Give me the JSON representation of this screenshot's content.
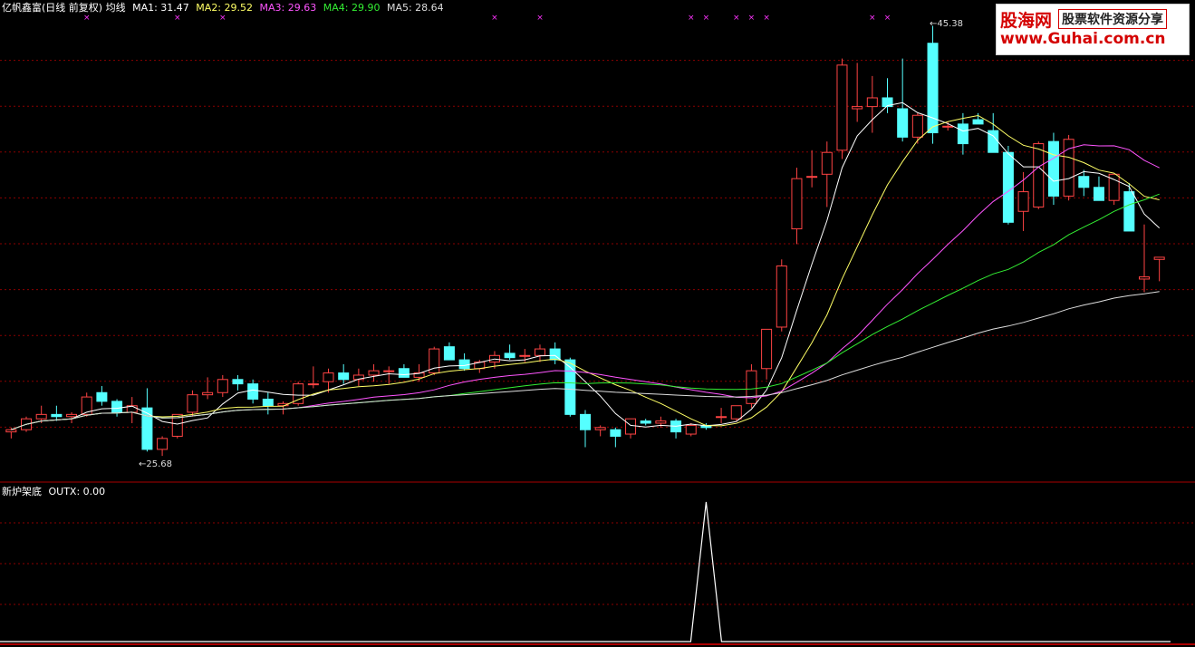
{
  "main_legend": {
    "title": "亿帆鑫富(日线 前复权) 均线",
    "ma": [
      {
        "label": "MA1: 31.47",
        "color": "#ffffff"
      },
      {
        "label": "MA2: 29.52",
        "color": "#ffff66"
      },
      {
        "label": "MA3: 29.63",
        "color": "#ff55ff"
      },
      {
        "label": "MA4: 29.90",
        "color": "#33ee33"
      },
      {
        "label": "MA5: 28.64",
        "color": "#dddddd"
      }
    ]
  },
  "sub_legend": {
    "title": "新炉架底",
    "value_label": "OUTX: 0.00"
  },
  "annotations": {
    "high_label": "45.38",
    "low_label": "25.68"
  },
  "watermark": {
    "brand": "股海网",
    "slogan": "股票软件资源分享",
    "url": "www.Guhai.com.cn"
  },
  "colors": {
    "up": "#ff4444",
    "down": "#55ffff",
    "grid": "#8b0000",
    "signal": "#ffffff"
  },
  "chart_data": {
    "type": "candlestick",
    "candles": [
      [
        26.8,
        27.0,
        26.5,
        26.9
      ],
      [
        26.9,
        27.5,
        26.8,
        27.4
      ],
      [
        27.4,
        28.0,
        27.2,
        27.6
      ],
      [
        27.6,
        28.0,
        27.3,
        27.5
      ],
      [
        27.5,
        27.7,
        27.2,
        27.6
      ],
      [
        27.6,
        28.6,
        27.5,
        28.4
      ],
      [
        28.6,
        28.9,
        28.0,
        28.2
      ],
      [
        28.2,
        28.3,
        27.5,
        27.7
      ],
      [
        27.7,
        28.4,
        27.2,
        28.0
      ],
      [
        27.9,
        28.8,
        25.9,
        26.0
      ],
      [
        26.0,
        26.6,
        25.7,
        26.5
      ],
      [
        26.6,
        27.6,
        26.5,
        27.6
      ],
      [
        27.7,
        28.7,
        27.5,
        28.5
      ],
      [
        28.5,
        29.3,
        28.3,
        28.6
      ],
      [
        28.6,
        29.4,
        28.4,
        29.2
      ],
      [
        29.2,
        29.4,
        28.7,
        29.0
      ],
      [
        29.0,
        29.2,
        28.1,
        28.3
      ],
      [
        28.3,
        28.6,
        27.6,
        28.0
      ],
      [
        28.0,
        28.2,
        27.6,
        28.1
      ],
      [
        28.1,
        29.1,
        28.0,
        29.0
      ],
      [
        29.0,
        29.8,
        28.8,
        29.0
      ],
      [
        29.1,
        29.7,
        28.6,
        29.5
      ],
      [
        29.5,
        29.9,
        29.0,
        29.2
      ],
      [
        29.2,
        29.7,
        28.9,
        29.4
      ],
      [
        29.4,
        29.9,
        29.1,
        29.6
      ],
      [
        29.6,
        29.8,
        29.0,
        29.6
      ],
      [
        29.7,
        29.9,
        29.3,
        29.3
      ],
      [
        29.3,
        29.9,
        29.1,
        29.5
      ],
      [
        29.5,
        30.7,
        29.4,
        30.6
      ],
      [
        30.7,
        30.9,
        30.1,
        30.1
      ],
      [
        30.1,
        30.4,
        29.6,
        29.7
      ],
      [
        29.7,
        30.1,
        29.5,
        30.0
      ],
      [
        30.0,
        30.5,
        29.7,
        30.3
      ],
      [
        30.4,
        30.8,
        30.1,
        30.2
      ],
      [
        30.3,
        30.6,
        30.0,
        30.3
      ],
      [
        30.3,
        30.8,
        30.0,
        30.6
      ],
      [
        30.6,
        30.9,
        29.9,
        30.1
      ],
      [
        30.1,
        30.2,
        27.5,
        27.6
      ],
      [
        27.6,
        27.8,
        26.1,
        26.9
      ],
      [
        26.9,
        27.1,
        26.6,
        27.0
      ],
      [
        26.9,
        27.0,
        26.1,
        26.6
      ],
      [
        26.7,
        27.4,
        26.5,
        27.4
      ],
      [
        27.3,
        27.4,
        27.1,
        27.2
      ],
      [
        27.2,
        27.5,
        27.0,
        27.3
      ],
      [
        27.3,
        27.4,
        26.5,
        26.8
      ],
      [
        26.7,
        27.2,
        26.6,
        27.1
      ],
      [
        27.1,
        27.2,
        26.9,
        27.0
      ],
      [
        27.5,
        27.9,
        27.2,
        27.5
      ],
      [
        27.4,
        28.0,
        27.3,
        28.0
      ],
      [
        28.1,
        29.9,
        27.9,
        29.6
      ],
      [
        29.7,
        31.5,
        29.2,
        31.5
      ],
      [
        31.6,
        34.7,
        31.4,
        34.4
      ],
      [
        36.1,
        38.9,
        35.4,
        38.4
      ],
      [
        38.5,
        39.7,
        38.0,
        38.5
      ],
      [
        38.6,
        40.1,
        37.1,
        39.6
      ],
      [
        39.7,
        43.9,
        39.3,
        43.6
      ],
      [
        41.6,
        43.7,
        41.0,
        41.7
      ],
      [
        41.7,
        43.1,
        40.5,
        42.1
      ],
      [
        42.1,
        43.0,
        41.4,
        41.7
      ],
      [
        41.6,
        43.9,
        40.1,
        40.3
      ],
      [
        40.3,
        41.4,
        40.0,
        41.3
      ],
      [
        44.6,
        45.4,
        40.0,
        40.5
      ],
      [
        40.8,
        41.0,
        40.6,
        40.8
      ],
      [
        40.9,
        41.4,
        39.5,
        40.0
      ],
      [
        41.1,
        41.4,
        40.9,
        40.9
      ],
      [
        40.6,
        41.4,
        40.2,
        39.6
      ],
      [
        39.6,
        39.9,
        36.3,
        36.4
      ],
      [
        36.9,
        38.7,
        36.0,
        37.8
      ],
      [
        37.1,
        40.1,
        37.0,
        40.0
      ],
      [
        40.1,
        40.5,
        37.2,
        37.6
      ],
      [
        37.6,
        40.4,
        37.4,
        40.2
      ],
      [
        38.5,
        38.8,
        37.6,
        38.0
      ],
      [
        38.0,
        38.5,
        37.6,
        37.4
      ],
      [
        37.4,
        38.5,
        37.2,
        38.6
      ],
      [
        37.8,
        38.2,
        36.4,
        36.0
      ],
      [
        33.8,
        36.3,
        33.2,
        33.9
      ],
      [
        34.7,
        34.8,
        33.7,
        34.8
      ]
    ],
    "ylim": [
      25.0,
      46.0
    ],
    "indicator": {
      "name": "OUTX",
      "signal_index": 50,
      "signal_value": 1
    }
  }
}
